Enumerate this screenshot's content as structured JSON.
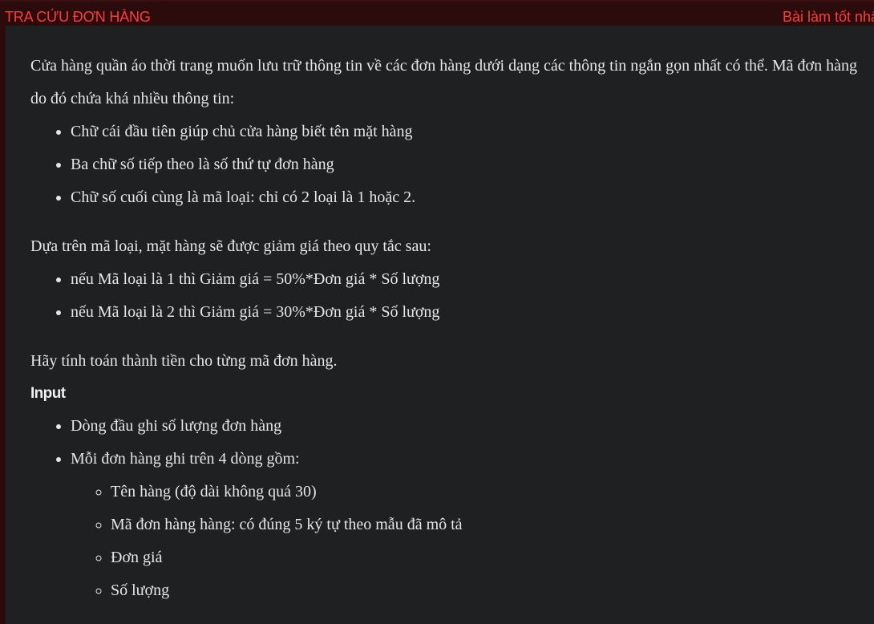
{
  "header": {
    "title": "TRA CỨU ĐƠN HÀNG",
    "badge": "Bài làm tốt nhất"
  },
  "content": {
    "intro": "Cửa hàng quần áo thời trang muốn lưu trữ thông tin về các đơn hàng dưới dạng các thông tin ngắn gọn nhất có thể. Mã đơn hàng do đó chứa khá nhiều thông tin:",
    "code_rules": [
      "Chữ cái đầu tiên giúp chủ cửa hàng biết tên mặt hàng",
      "Ba chữ số tiếp theo là số thứ tự đơn hàng",
      "Chữ số cuối cùng là mã loại: chỉ có 2 loại là 1 hoặc 2."
    ],
    "discount_intro": "Dựa trên mã loại, mặt hàng sẽ được giảm giá theo quy tắc sau:",
    "discount_rules": [
      "nếu Mã loại là 1 thì Giảm giá = 50%*Đơn giá * Số lượng",
      "nếu Mã loại là 2 thì Giảm giá = 30%*Đơn giá * Số lượng"
    ],
    "task": "Hãy tính toán thành tiền cho từng mã đơn hàng.",
    "input_heading": "Input",
    "input_items": [
      "Dòng đầu ghi số lượng đơn hàng",
      "Mỗi đơn hàng ghi trên 4 dòng gồm:"
    ],
    "order_fields": [
      "Tên hàng (độ dài không quá 30)",
      "Mã đơn hàng hàng: có đúng 5 ký tự theo mẫu đã mô tả",
      "Đơn giá",
      "Số lượng"
    ]
  },
  "colors": {
    "header_bg": "#2b0b0b",
    "accent_red": "#ff3c3c",
    "panel_bg": "#1f2022",
    "text": "#e6e6e6"
  }
}
